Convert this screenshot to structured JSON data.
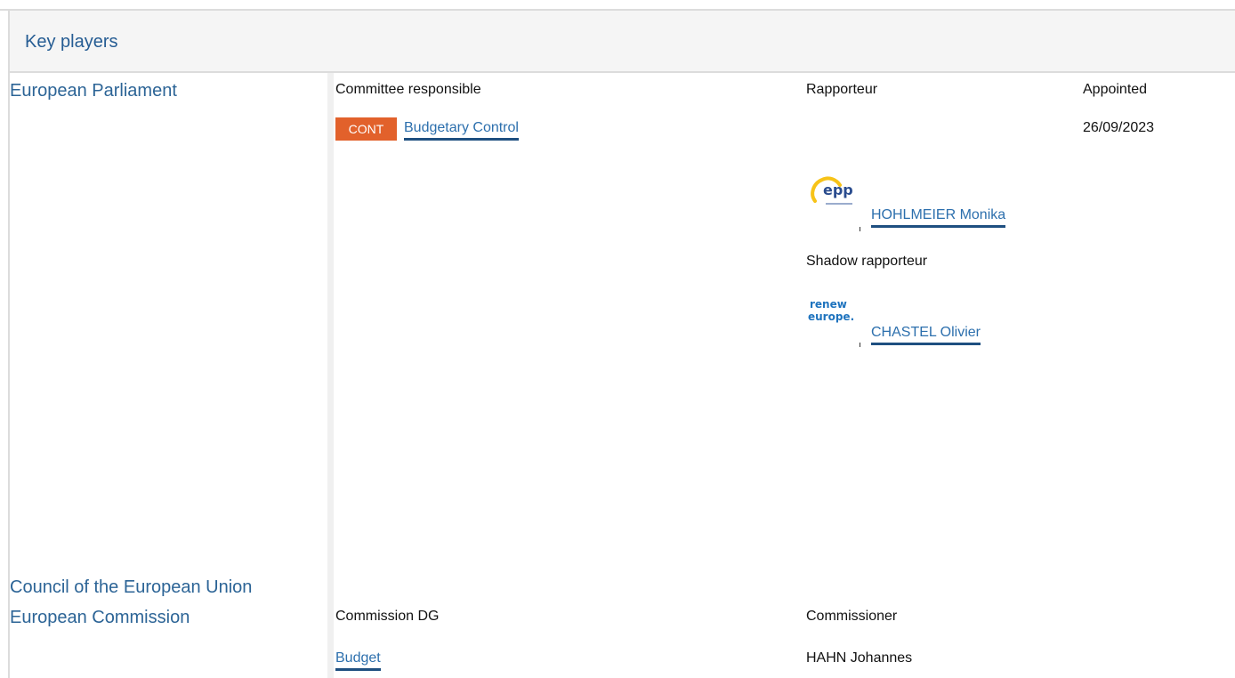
{
  "header": {
    "title": "Key players"
  },
  "institutions": {
    "parliament": "European Parliament",
    "council": "Council of the European Union",
    "commission": "European Commission"
  },
  "parliament": {
    "col_committee": "Committee responsible",
    "col_rapporteur": "Rapporteur",
    "col_appointed": "Appointed",
    "committee_code": "CONT",
    "committee_name": "Budgetary Control",
    "appointed_date": "26/09/2023",
    "rapporteur": {
      "group_logo": "epp-logo",
      "name": "HOHLMEIER Monika"
    },
    "shadow_label": "Shadow rapporteur",
    "shadow": {
      "group_logo": "renew-europe-logo",
      "name": "CHASTEL Olivier"
    },
    "colors": {
      "badge": "#e2612b",
      "link": "#2c6fad",
      "institution": "#2c6496"
    }
  },
  "commission": {
    "col_dg": "Commission DG",
    "col_commissioner": "Commissioner",
    "dg": "Budget",
    "commissioner": "HAHN Johannes"
  }
}
